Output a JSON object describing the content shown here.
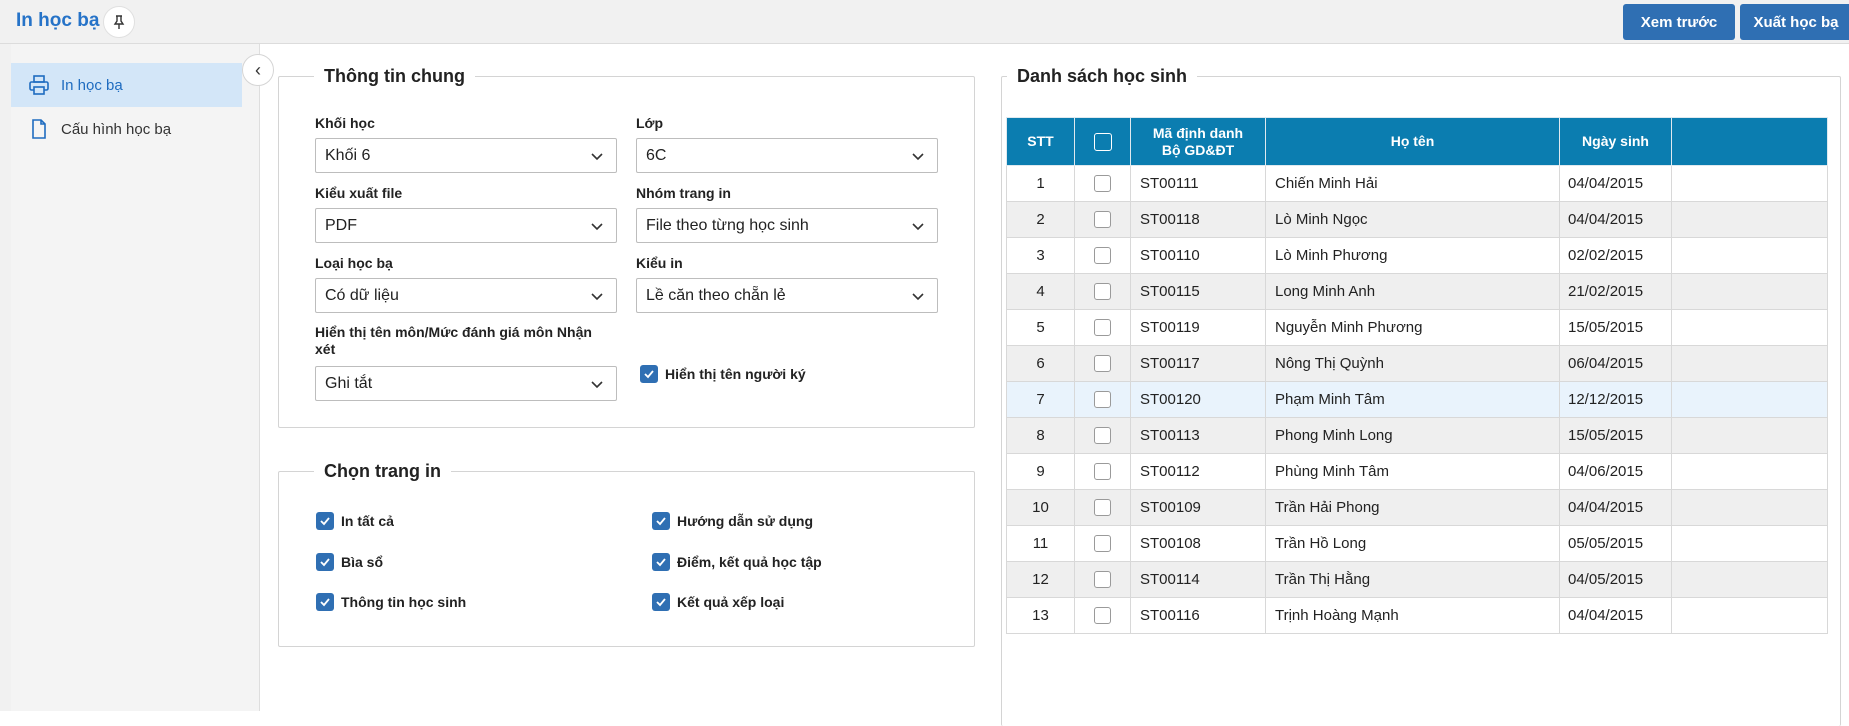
{
  "header": {
    "title": "In học bạ",
    "pin_icon": "pin-icon",
    "preview_label": "Xem trước",
    "export_label": "Xuất học bạ"
  },
  "sidebar": {
    "items": [
      {
        "label": "In học bạ",
        "icon": "printer-icon",
        "active": true
      },
      {
        "label": "Cấu hình học bạ",
        "icon": "document-icon",
        "active": false
      }
    ],
    "collapse_icon": "chevron-left-icon"
  },
  "general": {
    "legend": "Thông tin chung",
    "grade": {
      "label": "Khối học",
      "value": "Khối 6"
    },
    "class": {
      "label": "Lớp",
      "value": "6C"
    },
    "file_type": {
      "label": "Kiểu xuất file",
      "value": "PDF"
    },
    "print_group": {
      "label": "Nhóm trang in",
      "value": "File theo từng học sinh"
    },
    "record_type": {
      "label": "Loại học bạ",
      "value": "Có dữ liệu"
    },
    "print_style": {
      "label": "Kiểu in",
      "value": "Lề căn theo chẵn lẻ"
    },
    "subject_display": {
      "label": "Hiển thị tên môn/Mức đánh giá môn Nhận xét",
      "value": "Ghi tắt"
    },
    "show_signer": {
      "label": "Hiển thị tên người ký",
      "checked": true
    }
  },
  "pages": {
    "legend": "Chọn trang in",
    "options": [
      {
        "label": "In tất cả",
        "checked": true
      },
      {
        "label": "Hướng dẫn sử dụng",
        "checked": true
      },
      {
        "label": "Bìa sổ",
        "checked": true
      },
      {
        "label": "Điểm, kết quả học tập",
        "checked": true
      },
      {
        "label": "Thông tin học sinh",
        "checked": true
      },
      {
        "label": "Kết quả xếp loại",
        "checked": true
      }
    ]
  },
  "students": {
    "legend": "Danh sách học sinh",
    "columns": {
      "stt": "STT",
      "id_line1": "Mã định danh",
      "id_line2": "Bộ GD&ĐT",
      "name": "Họ tên",
      "dob": "Ngày sinh"
    },
    "rows": [
      {
        "stt": "1",
        "id": "ST00111",
        "name": "Chiến Minh Hải",
        "dob": "04/04/2015"
      },
      {
        "stt": "2",
        "id": "ST00118",
        "name": "Lò Minh Ngọc",
        "dob": "04/04/2015"
      },
      {
        "stt": "3",
        "id": "ST00110",
        "name": "Lò Minh Phương",
        "dob": "02/02/2015"
      },
      {
        "stt": "4",
        "id": "ST00115",
        "name": "Long Minh Anh",
        "dob": "21/02/2015"
      },
      {
        "stt": "5",
        "id": "ST00119",
        "name": "Nguyễn Minh Phương",
        "dob": "15/05/2015"
      },
      {
        "stt": "6",
        "id": "ST00117",
        "name": "Nông Thị Quỳnh",
        "dob": "06/04/2015"
      },
      {
        "stt": "7",
        "id": "ST00120",
        "name": "Phạm Minh Tâm",
        "dob": "12/12/2015"
      },
      {
        "stt": "8",
        "id": "ST00113",
        "name": "Phong Minh Long",
        "dob": "15/05/2015"
      },
      {
        "stt": "9",
        "id": "ST00112",
        "name": "Phùng Minh Tâm",
        "dob": "04/06/2015"
      },
      {
        "stt": "10",
        "id": "ST00109",
        "name": "Trần Hải Phong",
        "dob": "04/04/2015"
      },
      {
        "stt": "11",
        "id": "ST00108",
        "name": "Trần Hồ Long",
        "dob": "05/05/2015"
      },
      {
        "stt": "12",
        "id": "ST00114",
        "name": "Trần Thị Hằng",
        "dob": "04/05/2015"
      },
      {
        "stt": "13",
        "id": "ST00116",
        "name": "Trịnh Hoàng Mạnh",
        "dob": "04/04/2015"
      }
    ],
    "highlighted_row": 7
  },
  "colors": {
    "accent": "#2f6fb3",
    "table_header": "#0b7db0",
    "title": "#2673c8"
  }
}
